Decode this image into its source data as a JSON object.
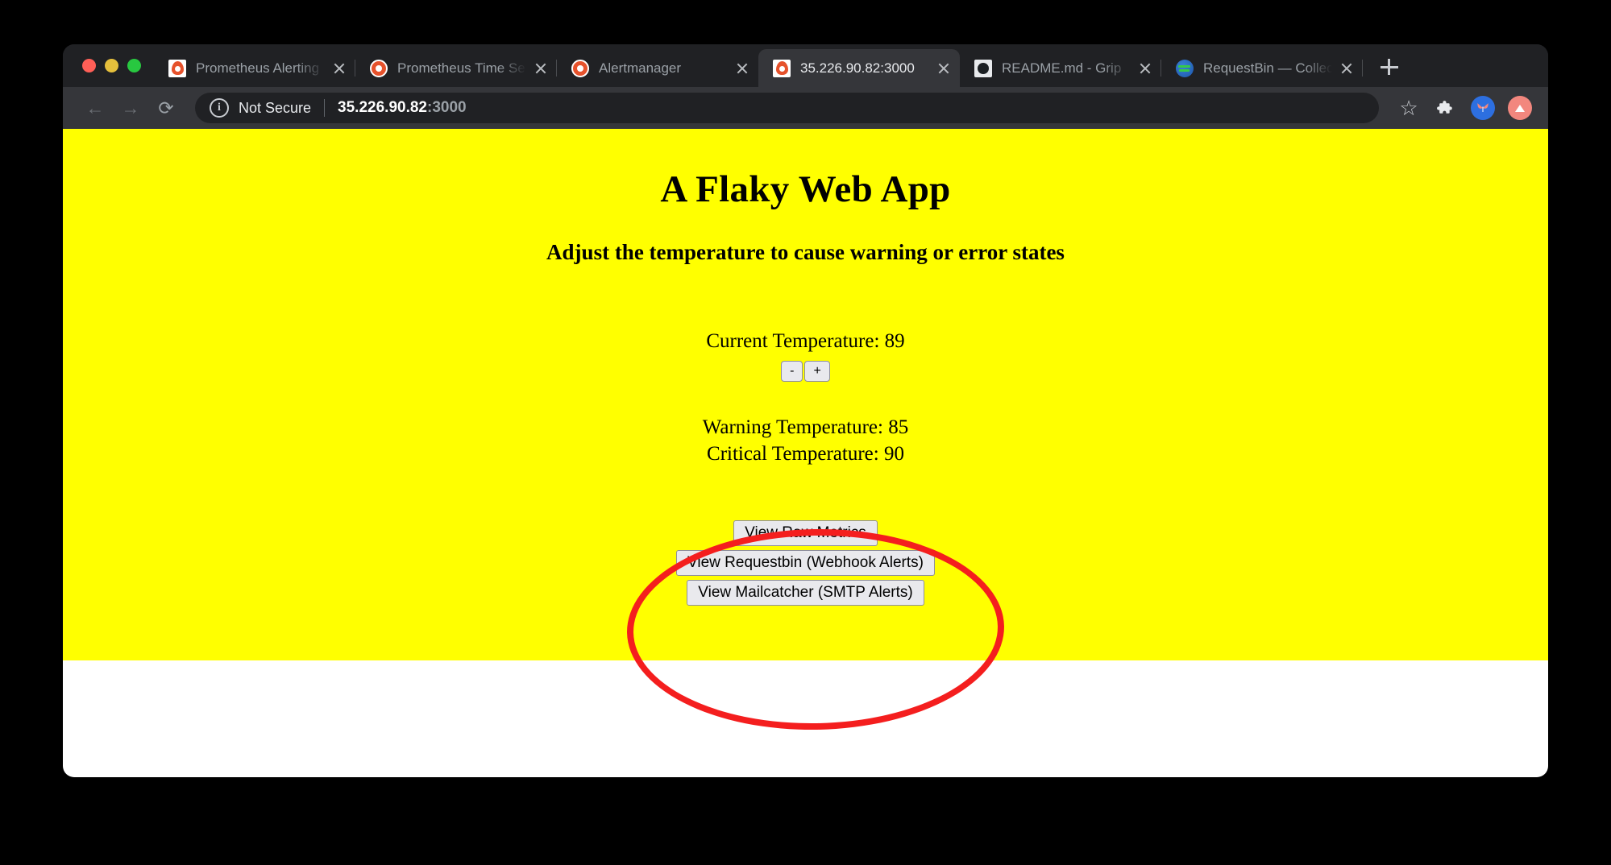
{
  "browser": {
    "traffic_lights": [
      "close",
      "minimize",
      "maximize"
    ],
    "tabs": [
      {
        "title": "Prometheus Alerting",
        "favicon": "prometheus-icon",
        "active": false
      },
      {
        "title": "Prometheus Time Ser",
        "favicon": "prometheus-icon",
        "active": false
      },
      {
        "title": "Alertmanager",
        "favicon": "prometheus-icon",
        "active": false
      },
      {
        "title": "35.226.90.82:3000",
        "favicon": "prometheus-icon",
        "active": true
      },
      {
        "title": "README.md - Grip",
        "favicon": "github-icon",
        "active": false
      },
      {
        "title": "RequestBin — Collect",
        "favicon": "requestbin-icon",
        "active": false
      }
    ],
    "new_tab_label": "+",
    "toolbar": {
      "back_icon": "←",
      "forward_icon": "→",
      "reload_icon": "⟳",
      "info_icon": "i",
      "security_label": "Not Secure",
      "url_host": "35.226.90.82",
      "url_port": ":3000",
      "bookmark_icon": "☆",
      "extensions_icon": "puzzle-icon",
      "extension_avatar_icon": "butterfly-icon",
      "profile_avatar_icon": "profile-icon"
    },
    "close_label": "×"
  },
  "page": {
    "title": "A Flaky Web App",
    "subtitle": "Adjust the temperature to cause warning or error states",
    "current_temperature_label": "Current Temperature: 89",
    "decrement_label": "-",
    "increment_label": "+",
    "warning_temperature_label": "Warning Temperature: 85",
    "critical_temperature_label": "Critical Temperature: 90",
    "links": [
      "View Raw Metrics",
      "View Requestbin (Webhook Alerts)",
      "View Mailcatcher (SMTP Alerts)"
    ],
    "background_color": "#ffff00",
    "annotation_color": "#f41e1e"
  }
}
